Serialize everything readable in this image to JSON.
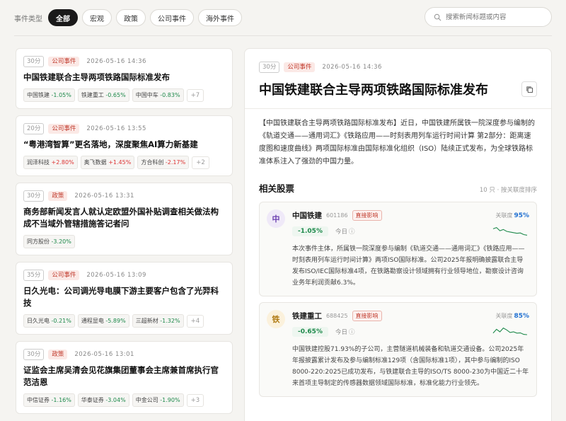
{
  "filters": {
    "label": "事件类型",
    "chips": [
      "全部",
      "宏观",
      "政策",
      "公司事件",
      "海外事件"
    ],
    "search_placeholder": "搜索新闻标题或内容"
  },
  "events": [
    {
      "score": "30分",
      "category": "公司事件",
      "time": "2026-05-16 14:36",
      "title": "中国铁建联合主导两项铁路国际标准发布",
      "stocks": [
        {
          "name": "中国铁建",
          "chg": "-1.05%",
          "dir": "down"
        },
        {
          "name": "铁建重工",
          "chg": "-0.65%",
          "dir": "down"
        },
        {
          "name": "中国中车",
          "chg": "-0.83%",
          "dir": "down"
        }
      ],
      "more": "+7"
    },
    {
      "score": "20分",
      "category": "公司事件",
      "time": "2026-05-16 13:55",
      "title": "“粤港湾智算”更名落地，深度聚焦AI算力新基建",
      "stocks": [
        {
          "name": "润泽科技",
          "chg": "+2.80%",
          "dir": "up"
        },
        {
          "name": "奥飞数据",
          "chg": "+1.45%",
          "dir": "up"
        },
        {
          "name": "方合科创",
          "chg": "-2.17%",
          "dir": "down"
        }
      ],
      "more": "+2"
    },
    {
      "score": "30分",
      "category": "政策",
      "time": "2026-05-16 13:31",
      "title": "商务部新闻发言人就认定欧盟外国补贴调查相关做法构成不当域外管辖措施答记者问",
      "stocks": [
        {
          "name": "同方股份",
          "chg": "-3.20%",
          "dir": "down"
        }
      ],
      "more": ""
    },
    {
      "score": "35分",
      "category": "公司事件",
      "time": "2026-05-16 13:09",
      "title": "日久光电：公司调光导电膜下游主要客户包含了光羿科技",
      "stocks": [
        {
          "name": "日久光电",
          "chg": "-0.21%",
          "dir": "down"
        },
        {
          "name": "通程显电",
          "chg": "-5.89%",
          "dir": "down"
        },
        {
          "name": "三超新材",
          "chg": "-1.32%",
          "dir": "down"
        }
      ],
      "more": "+4"
    },
    {
      "score": "30分",
      "category": "政策",
      "time": "2026-05-16 13:01",
      "title": "证监会主席吴清会见花旗集团董事会主席兼首席执行官范洁恩",
      "stocks": [
        {
          "name": "中信证券",
          "chg": "-1.16%",
          "dir": "down"
        },
        {
          "name": "华泰证券",
          "chg": "-3.04%",
          "dir": "down"
        },
        {
          "name": "中金公司",
          "chg": "-1.90%",
          "dir": "down"
        }
      ],
      "more": "+3"
    }
  ],
  "detail": {
    "score": "30分",
    "category": "公司事件",
    "time": "2026-05-16 14:36",
    "title": "中国铁建联合主导两项铁路国际标准发布",
    "summary": "【中国铁建联合主导两项铁路国际标准发布】近日，中国铁建所属铁一院深度参与编制的《轨道交通——通用词汇》《铁路应用——时刻表用列车运行时间计算 第2部分：距离速度图和速度曲线》两项国际标准由国际标准化组织（ISO）陆续正式发布，为全球铁路标准体系注入了强劲的中国力量。",
    "related_title": "相关股票",
    "related_sort": "10 只 · 按关联度排序",
    "related": [
      {
        "avatar": "中",
        "name": "中国铁建",
        "code": "601186",
        "impact": "直接影响",
        "rel_label": "关联度",
        "rel_value": "95%",
        "chg": "-1.05%",
        "today": "今日",
        "desc": "本次事件主体，所属铁一院深度参与编制《轨道交通——通用词汇》《铁路应用——时刻表用列车运行时间计算》两项ISO国际标准。公司2025年报明确披露联合主导发布ISO/IEC国际标准4项，在铁路勘察设计领域拥有行业领导地位，勘察设计咨询业务年利润贡献6.3%。",
        "spark": [
          0.3,
          0.2,
          0.45,
          0.35,
          0.5,
          0.55,
          0.6,
          0.65,
          0.62,
          0.75,
          0.8
        ]
      },
      {
        "avatar": "铁",
        "name": "铁建重工",
        "code": "688425",
        "impact": "直接影响",
        "rel_label": "关联度",
        "rel_value": "85%",
        "chg": "-0.65%",
        "today": "今日",
        "desc": "中国铁建控股71.93%的子公司，主营隧道机械装备和轨道交通设备。公司2025年年报披露累计发布及参与编制标准129项（含国际标准1项），其中参与编制的ISO 8000-220:2025已成功发布，与铁建联合主导的ISO/TS 8000-230为中国近二十年来首项主导制定的传感器数据领域国际标准，标准化能力行业领先。",
        "spark": [
          0.6,
          0.3,
          0.5,
          0.2,
          0.35,
          0.55,
          0.5,
          0.6,
          0.58,
          0.7,
          0.72
        ]
      }
    ]
  }
}
